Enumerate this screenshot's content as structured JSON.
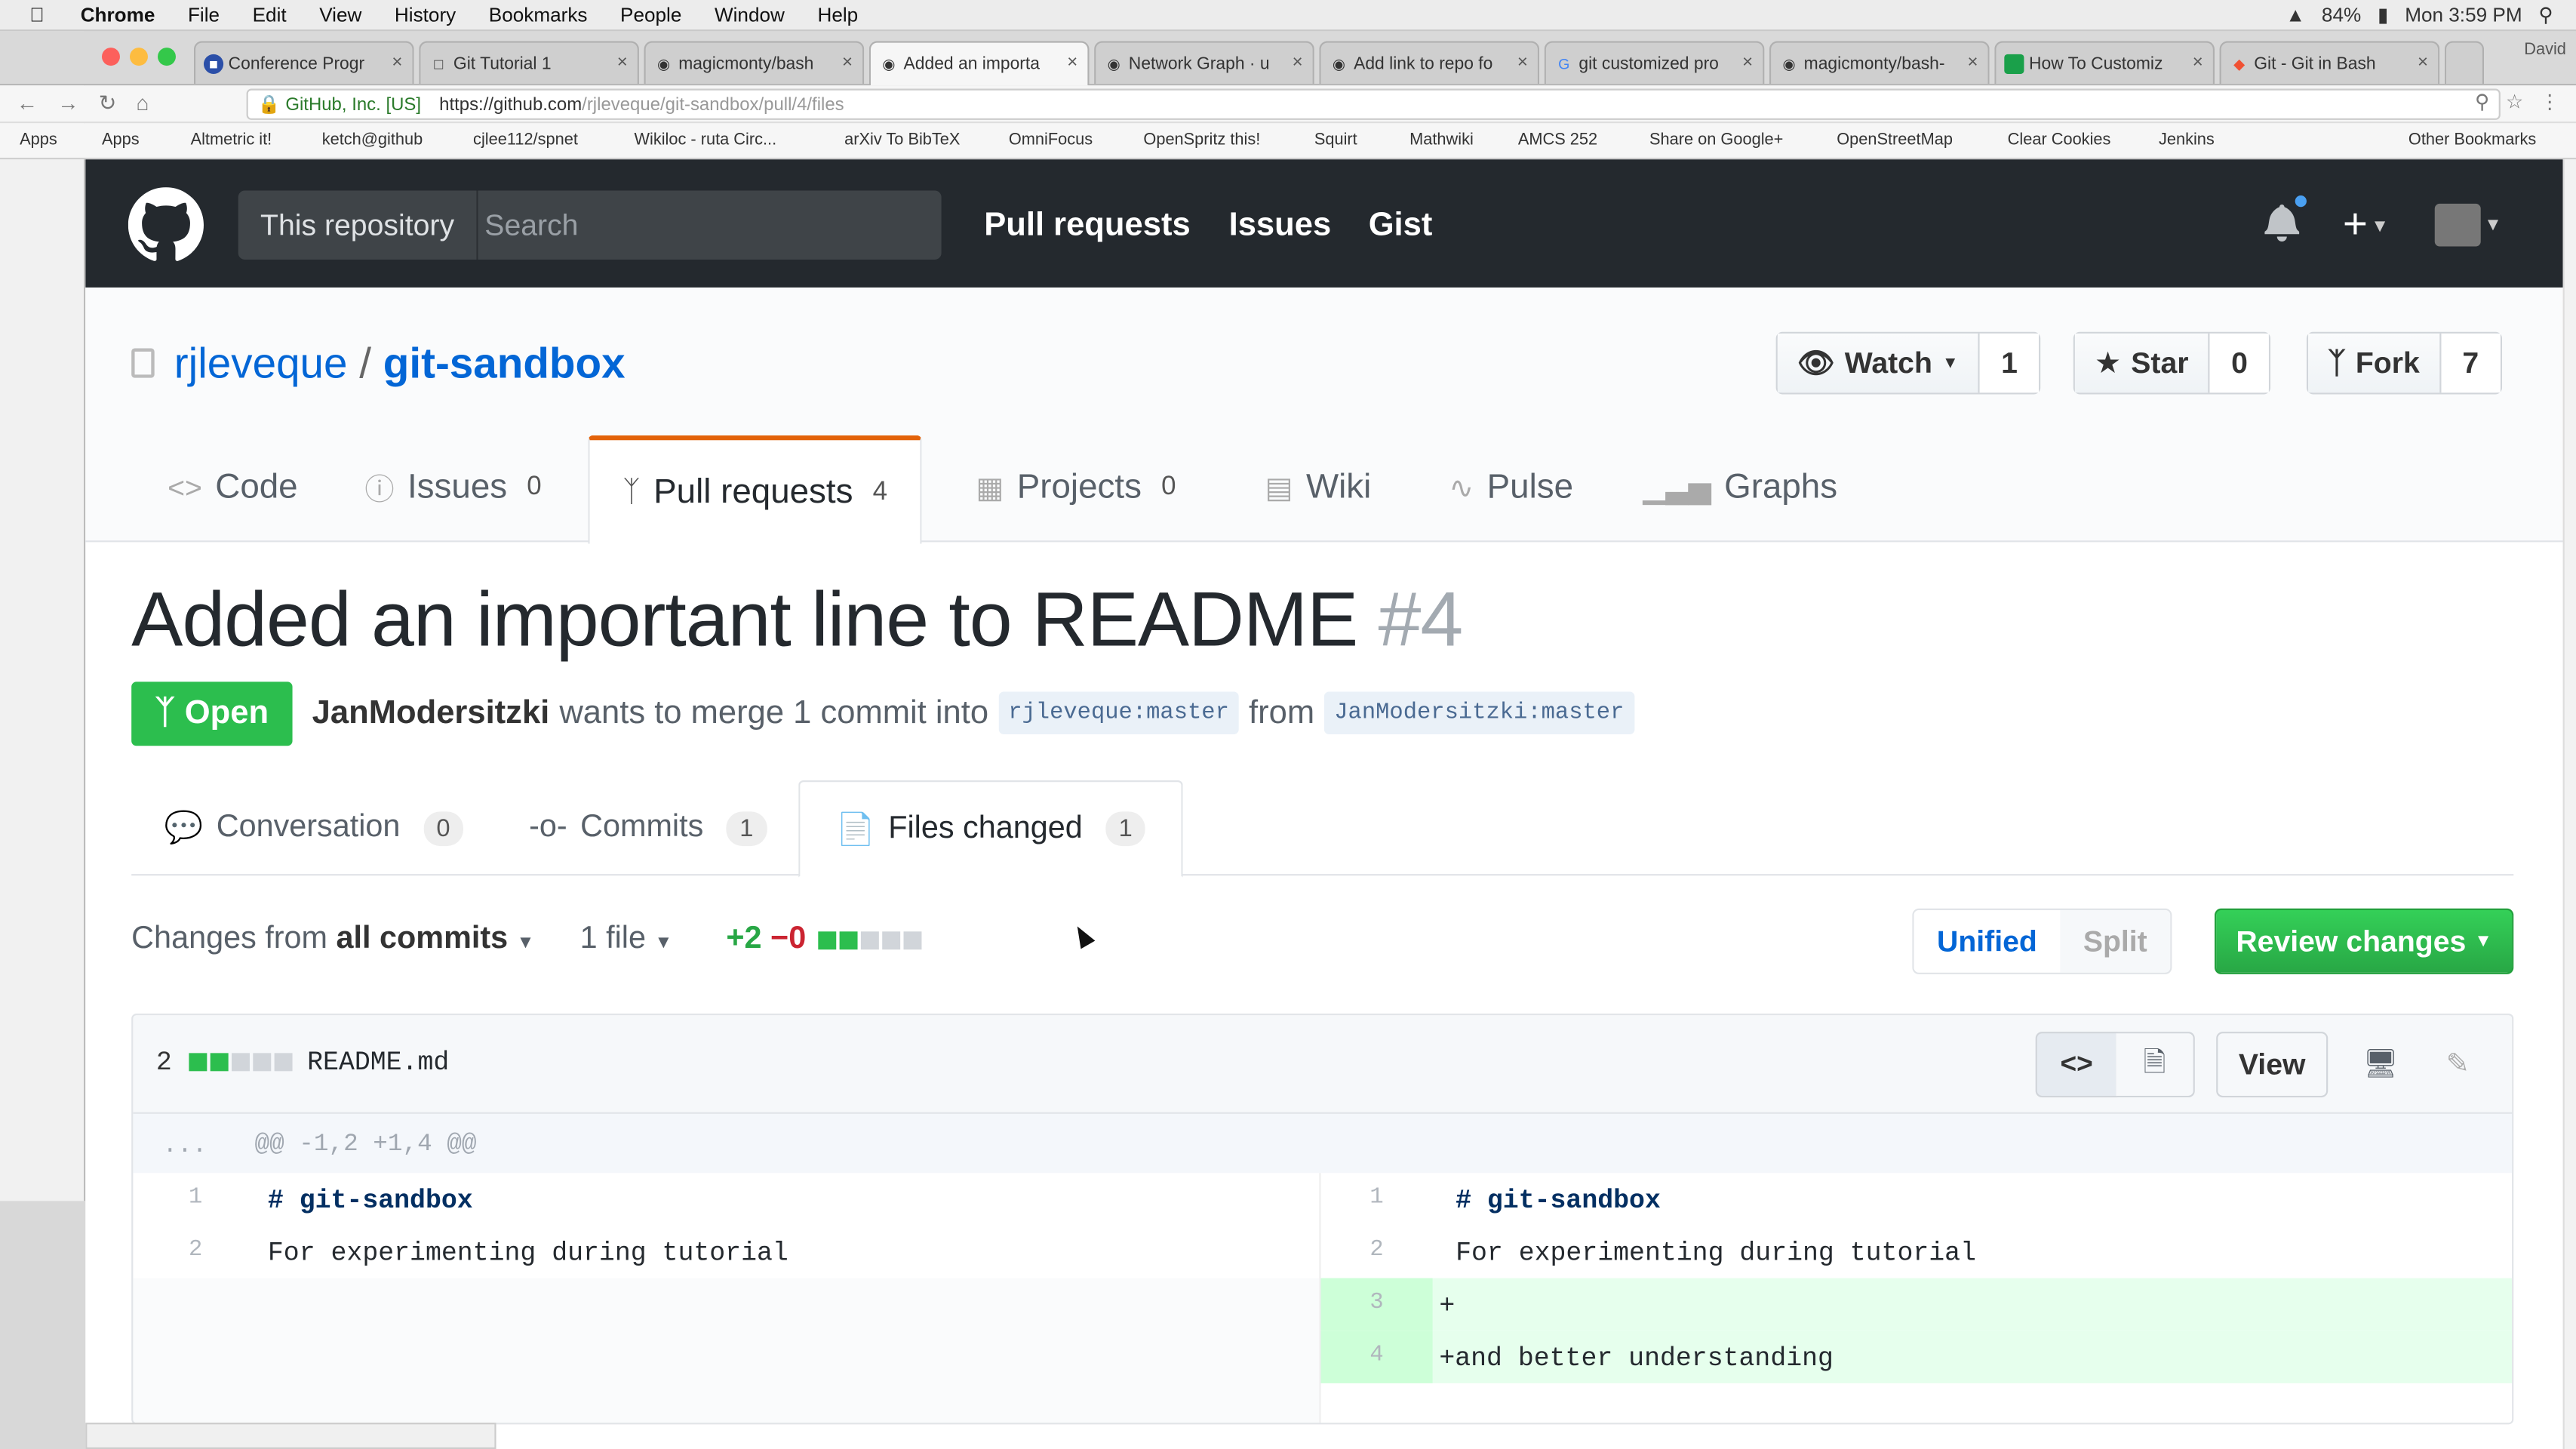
{
  "menubar": {
    "apple": "",
    "items": [
      "Chrome",
      "File",
      "Edit",
      "View",
      "History",
      "Bookmarks",
      "People",
      "Window",
      "Help"
    ],
    "battery": "84%",
    "clock": "Mon 3:59 PM"
  },
  "tabs": [
    {
      "title": "Conference Progr"
    },
    {
      "title": "Git Tutorial 1"
    },
    {
      "title": "magicmonty/bash"
    },
    {
      "title": "Added an importa"
    },
    {
      "title": "Network Graph · u"
    },
    {
      "title": "Add link to repo fo"
    },
    {
      "title": "git customized pro"
    },
    {
      "title": "magicmonty/bash-"
    },
    {
      "title": "How To Customiz"
    },
    {
      "title": "Git - Git in Bash"
    }
  ],
  "profile_name": "David",
  "url": {
    "ev_label": "GitHub, Inc. [US]",
    "scheme_host": "https://github.com",
    "path": "/rjleveque/git-sandbox/pull/4/files"
  },
  "bookmarks": [
    "Apps",
    "Altmetric it!",
    "ketch@github",
    "cjlee112/spnet",
    "Wikiloc - ruta Circ...",
    "arXiv To BibTeX",
    "OmniFocus",
    "OpenSpritz this!",
    "Squirt",
    "Mathwiki",
    "AMCS 252",
    "Share on Google+",
    "OpenStreetMap",
    "Clear Cookies",
    "Jenkins",
    "Other Bookmarks"
  ],
  "header": {
    "scope": "This repository",
    "search_placeholder": "Search",
    "nav": [
      "Pull requests",
      "Issues",
      "Gist"
    ],
    "plus": "+"
  },
  "repo": {
    "owner": "rjleveque",
    "separator": "/",
    "name": "git-sandbox",
    "watch": {
      "label": "Watch",
      "count": "1"
    },
    "star": {
      "label": "Star",
      "count": "0"
    },
    "fork": {
      "label": "Fork",
      "count": "7"
    }
  },
  "repo_tabs": {
    "code": "Code",
    "issues": {
      "label": "Issues",
      "count": "0"
    },
    "pulls": {
      "label": "Pull requests",
      "count": "4"
    },
    "projects": {
      "label": "Projects",
      "count": "0"
    },
    "wiki": "Wiki",
    "pulse": "Pulse",
    "graphs": "Graphs"
  },
  "pr": {
    "title": "Added an important line to README",
    "number": "#4",
    "state": "Open",
    "author": "JanModersitzki",
    "merge_text": "wants to merge 1 commit into",
    "base_ref": "rjleveque:master",
    "from_text": "from",
    "head_ref": "JanModersitzki:master"
  },
  "pr_tabs": {
    "conversation": {
      "label": "Conversation",
      "count": "0"
    },
    "commits": {
      "label": "Commits",
      "count": "1"
    },
    "files": {
      "label": "Files changed",
      "count": "1"
    }
  },
  "toolbar": {
    "changes_prefix": "Changes from",
    "changes_value": "all commits",
    "files_dropdown": "1 file",
    "additions": "+2",
    "deletions": "−0",
    "unified": "Unified",
    "split": "Split",
    "review": "Review changes"
  },
  "file": {
    "change_count": "2",
    "name": "README.md",
    "view_label": "View",
    "hunk_dots": "...",
    "hunk_header": "@@ -1,2 +1,4 @@",
    "left_lines": [
      {
        "num": "1",
        "text": "# git-sandbox"
      },
      {
        "num": "2",
        "text": "For experimenting during tutorial"
      }
    ],
    "right_lines": [
      {
        "num": "1",
        "text": "# git-sandbox"
      },
      {
        "num": "2",
        "text": "For experimenting during tutorial"
      },
      {
        "num": "3",
        "text": "+"
      },
      {
        "num": "4",
        "text": "+and better understanding"
      }
    ]
  },
  "colors": {
    "header_bg": "#24292e",
    "open_green": "#2cbe4e",
    "link_blue": "#0366d6",
    "tab_accent": "#e36209",
    "add_bg": "#e6ffed"
  }
}
